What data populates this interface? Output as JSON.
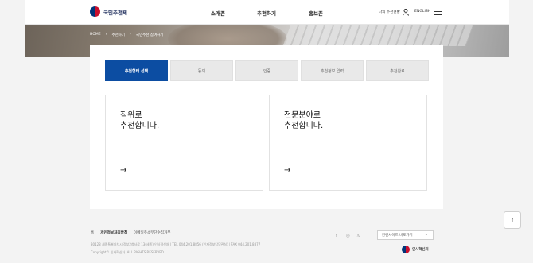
{
  "header": {
    "logo_text": "국민추천제",
    "nav": [
      "소개존",
      "추천하기",
      "홍보존"
    ],
    "my_recommend": "나의 추천현황",
    "english": "ENGLISH"
  },
  "breadcrumb": [
    "HOME",
    "추천하기",
    "국민추천 참여하기"
  ],
  "steps": [
    "추천형태 선택",
    "동의",
    "인증",
    "추천정보 입력",
    "추천완료"
  ],
  "cards": [
    {
      "title": "직위로\n추천합니다.",
      "arrow": "→"
    },
    {
      "title": "전문분야로\n추천합니다.",
      "arrow": "→"
    }
  ],
  "footer": {
    "links": [
      "홈",
      "개인정보처리방침",
      "이메일주소무단수집거부"
    ],
    "address": "30128 세종특별자치시 정부2청사로 13(세종) 인사혁신처 | TEL 044.201.8856 (인재정보담당관실) | FAX 044.201.8877",
    "copyright": "Copyright© 인사혁신처. ALL RIGHTS RESERVED.",
    "social": [
      "f",
      "◎",
      "𝕏"
    ],
    "family_site": "관련사이트 바로가기",
    "logo_text": "인사혁신처"
  },
  "top_button": "↑"
}
